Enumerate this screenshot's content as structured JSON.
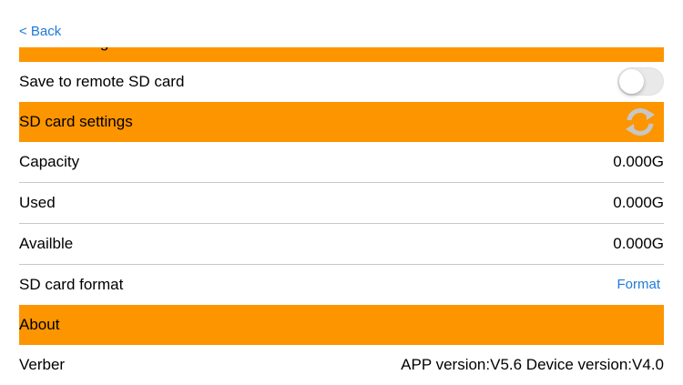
{
  "nav": {
    "back_label": "< Back"
  },
  "sections": {
    "partial_header_label": "Media storage location",
    "save_remote_label": "Save to remote SD card",
    "save_remote_enabled": false,
    "sd_settings_label": "SD card settings",
    "capacity_label": "Capacity",
    "capacity_value": "0.000G",
    "used_label": "Used",
    "used_value": "0.000G",
    "available_label": "Availble",
    "available_value": "0.000G",
    "format_label": "SD card format",
    "format_action": "Format",
    "about_label": "About",
    "verber_label": "Verber",
    "version_value": "APP version:V5.6 Device version:V4.0"
  },
  "icons": {
    "refresh": "refresh-icon"
  },
  "colors": {
    "header_bg": "#fd9500",
    "link": "#1f7ad9",
    "separator": "#c8c7cc",
    "toggle_off": "#e9e9ea",
    "refresh_icon": "#c7c7c7"
  }
}
